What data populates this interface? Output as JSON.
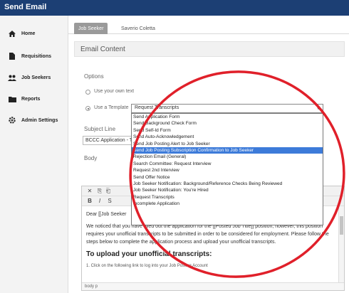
{
  "app": {
    "title": "Send Email"
  },
  "sidebar": {
    "items": [
      {
        "label": "Home",
        "icon": "home-icon"
      },
      {
        "label": "Requisitions",
        "icon": "document-icon"
      },
      {
        "label": "Job Seekers",
        "icon": "users-icon"
      },
      {
        "label": "Reports",
        "icon": "folder-icon"
      },
      {
        "label": "Admin Settings",
        "icon": "gear-icon"
      }
    ]
  },
  "tabs": [
    {
      "label": "Job Seeker",
      "active": true
    },
    {
      "label": "Saverio Coletta",
      "active": false
    }
  ],
  "section": {
    "title": "Email Content"
  },
  "options": {
    "label": "Options",
    "own_text_label": "Use your own text",
    "template_label": "Use a Template",
    "selected_template": "Request Transcripts"
  },
  "template_options": [
    "Send Application Form",
    "Send Background Check Form",
    "Send Self-Id Form",
    "Send Auto-Acknowledgement",
    "Send Job Posting Alert to Job Seeker",
    "Send Job Posting Subscription Confirmation to Job Seeker",
    "Rejection Email (General)",
    "Search Committee: Request Interview",
    "Request 2nd Interview",
    "Send Offer Notice",
    "Job Seeker Notification: Background/Reference Checks Being Reviewed",
    "Job Seeker Notification: You're Hired",
    "Request Transcripts",
    "Incomplete Application"
  ],
  "highlighted_option_index": 5,
  "subject": {
    "label": "Subject Line",
    "value": "BCCC Application - T"
  },
  "body": {
    "label": "Body",
    "greeting": "Dear [[Job Seeker",
    "paragraph1": "We noticed that you have filled out the application for the [[Posted Job Title]] position, however, this position requires your unofficial transcripts to be submitted in order to be considered for employment. Please follow the steps below to complete the application process and upload your unofficial transcripts.",
    "heading": "To upload your unofficial transcripts:",
    "step1": "1. Click on the following link to log into your Job Posting Account",
    "status_path": "body  p"
  },
  "colors": {
    "topbar": "#1c3f74",
    "highlight": "#3d7bd9",
    "annotation": "#e0202a"
  }
}
